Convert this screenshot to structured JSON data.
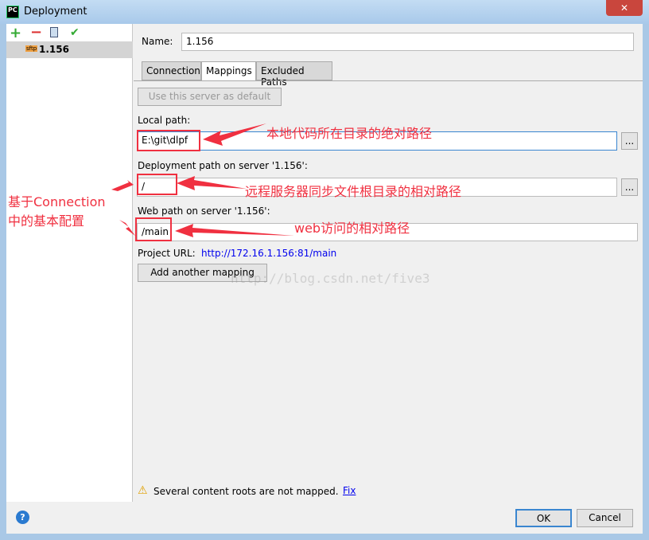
{
  "window": {
    "title": "Deployment",
    "close": "✕"
  },
  "sidebar": {
    "toolbar": [
      "add-icon",
      "remove-icon",
      "copy-icon",
      "default-icon"
    ],
    "servers": [
      {
        "badge": "sftp",
        "name": "1.156"
      }
    ]
  },
  "form": {
    "name_label": "Name:",
    "name_value": "1.156",
    "tabs": [
      {
        "label": "Connection"
      },
      {
        "label": "Mappings",
        "active": true
      },
      {
        "label": "Excluded Paths"
      }
    ],
    "default_button": "Use this server as default",
    "local_label": "Local path:",
    "local_value": "E:\\git\\dlpf",
    "deploy_label": "Deployment path on server '1.156':",
    "deploy_value": "/",
    "web_label": "Web path on server '1.156':",
    "web_value": "/main",
    "browse": "...",
    "url_label": "Project URL:",
    "url_value": "http://172.16.1.156:81/main",
    "add_mapping": "Add another mapping",
    "warning": "Several content roots are not mapped.",
    "fix": "Fix"
  },
  "annotations": {
    "local": "本地代码所在目录的绝对路径",
    "deploy": "远程服务器同步文件根目录的相对路径",
    "web": "web访问的相对路径",
    "left1": "基于Connection",
    "left2": "中的基本配置",
    "color": "#f03040"
  },
  "watermark": "http://blog.csdn.net/five3",
  "footer": {
    "help": "?",
    "ok": "OK",
    "cancel": "Cancel"
  }
}
